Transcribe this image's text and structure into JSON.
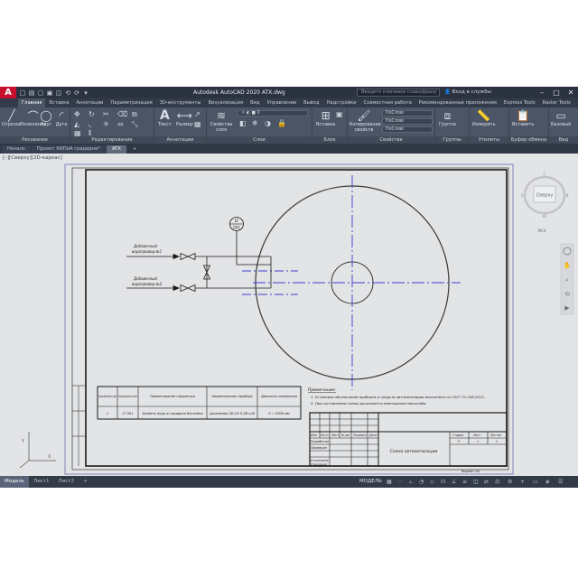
{
  "titlebar": {
    "logo": "A",
    "title": "Autodesk AutoCAD 2020   ATX.dwg",
    "search_placeholder": "Введите ключевое слово/фразу",
    "signin": "Вход в службы",
    "quick_access": [
      "□",
      "▤",
      "▢",
      "▣",
      "◫",
      "⟲",
      "⟳",
      "▾"
    ]
  },
  "ribbon_tabs": [
    "Главная",
    "Вставка",
    "Аннотации",
    "Параметризация",
    "3D-инструменты",
    "Визуализация",
    "Вид",
    "Управление",
    "Вывод",
    "Надстройки",
    "Совместная работа",
    "Рекомендованные приложения",
    "Express Tools",
    "Raster Tools"
  ],
  "ribbon_groups": {
    "draw": {
      "label": "Рисование",
      "tools": [
        "Отрезок",
        "Полилиния",
        "Круг",
        "Дуга"
      ]
    },
    "modify": {
      "label": "Редактирование"
    },
    "annotation": {
      "label": "Аннотации",
      "tools": [
        "Текст",
        "Размер"
      ]
    },
    "layers": {
      "label": "Слои",
      "tool": "Свойства слоя"
    },
    "block": {
      "label": "Блок",
      "tool": "Вставка"
    },
    "properties": {
      "label": "Свойства",
      "tool": "Копирование свойств",
      "boxes": [
        "ПоСлою",
        "ПоСлою",
        "ПоСлою"
      ]
    },
    "groups": {
      "label": "Группы",
      "tool": "Группа"
    },
    "utilities": {
      "label": "Утилиты",
      "tool": "Измерить"
    },
    "clipboard": {
      "label": "Буфер обмена",
      "tool": "Вставить"
    },
    "view": {
      "label": "Вид",
      "tool": "Базовый"
    }
  },
  "doc_tabs": [
    "Начало",
    "Проект КИПиА градирни*",
    "ATX"
  ],
  "viewport_label": "[–][Сверху][2D-каркас]",
  "viewcube": {
    "face": "Сверху",
    "north": "С",
    "south": "Ю",
    "west": "З",
    "east": "В",
    "wcs": "МСК"
  },
  "drawing": {
    "pipe1": [
      "Добавочный",
      "водопровод №1"
    ],
    "pipe2": [
      "Добавочный",
      "водопровод №2"
    ],
    "instrument_top": "LT",
    "instrument_bottom": "001",
    "notes_title": "Примечание:",
    "notes": [
      "1. Установка обозначений приборов и средств автоматизации выполнена по ГОСТ 21.208-2013.",
      "2. При составлении схемы допускается уменьшение масштаба."
    ],
    "table_headers": [
      "Позиция обозначения на схеме",
      "Позиция обозначения в проекте",
      "Наименование параметра",
      "Наименование прибора",
      "Диапазон измерения"
    ],
    "table_row": [
      "1",
      "LT 001",
      "Уровень воды в градирне бассейна",
      "уровнемер 3D-СУ-5-2В кл5",
      "0 ÷ 2000 мм"
    ],
    "stamp_roles": [
      "Разработал",
      "Проверил",
      "Н.контроль",
      "Утвердил"
    ],
    "stamp_cols": [
      "Изм.",
      "Кол.уч.",
      "Лист",
      "№ док.",
      "Подпись",
      "Дата"
    ],
    "stamp_small_heads": [
      "Стадия",
      "Лист",
      "Листов"
    ],
    "stamp_small_vals": [
      "Р",
      "1",
      "1"
    ],
    "stamp_title": "Схема автоматизации",
    "format_label": "Формат A4"
  },
  "ucs": {
    "x": "X",
    "y": "Y"
  },
  "status": {
    "tabs": [
      "Модель",
      "Лист1",
      "Лист2",
      "+"
    ],
    "model_label": "МОДЕЛЬ"
  },
  "colors": {
    "accent": "#c8102e",
    "ribbon": "#4b5566",
    "canvas": "#e3e4e6",
    "axis": "#3c3cd0"
  }
}
